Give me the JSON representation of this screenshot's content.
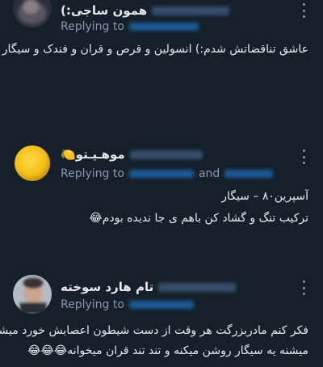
{
  "tweets": [
    {
      "display_name": "همون ساجی:)",
      "replying_label": "Replying to",
      "and_label": "",
      "lines": [
        "عاشق تناقضاتش شدم:) انسولین و قرص و قران و فندک و سیگار"
      ]
    },
    {
      "display_name": "موهـیـتو🍋",
      "replying_label": "Replying to",
      "and_label": "and",
      "lines": [
        "آسپرین۸۰ – سیگار",
        "ترکیب تنگ و گشاد کن باهم ی جا ندیده بودم😂"
      ]
    },
    {
      "display_name": "تام هارد سوخته",
      "replying_label": "Replying to",
      "and_label": "",
      "lines": [
        "فکر کنم مادربزرگت هر وقت از دست شیطون اعصابش خورد میشه",
        "میشنه یه سیگار روشن میکنه و تند تند قران میخوانه😂😂😂"
      ]
    }
  ],
  "colors": {
    "background": "#15202b",
    "text": "#e7e9ea",
    "secondary": "#8b98a5",
    "mention": "#1d9bf0"
  },
  "icons": [
    "more-options-icon"
  ]
}
